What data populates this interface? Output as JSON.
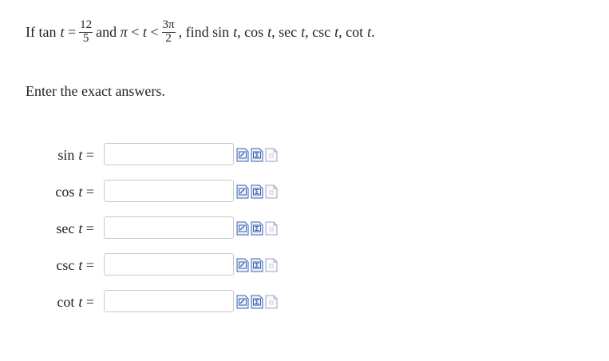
{
  "question": {
    "prefix": "If",
    "fn": "tan",
    "var": "t",
    "eq": "=",
    "frac1_num": "12",
    "frac1_den": "5",
    "and": "and",
    "pi": "π",
    "lt1": "<",
    "var2": "t",
    "lt2": "<",
    "frac2_num": "3π",
    "frac2_den": "2",
    "comma": ",",
    "find": "find",
    "targets": [
      {
        "fn": "sin",
        "var": "t",
        "sep": ","
      },
      {
        "fn": "cos",
        "var": "t",
        "sep": ","
      },
      {
        "fn": "sec",
        "var": "t",
        "sep": ","
      },
      {
        "fn": "csc",
        "var": "t",
        "sep": ","
      },
      {
        "fn": "cot",
        "var": "t",
        "sep": "."
      }
    ]
  },
  "instructions": "Enter the exact answers.",
  "answers": [
    {
      "fn": "sin",
      "var": "t",
      "eq": "=",
      "value": ""
    },
    {
      "fn": "cos",
      "var": "t",
      "eq": "=",
      "value": ""
    },
    {
      "fn": "sec",
      "var": "t",
      "eq": "=",
      "value": ""
    },
    {
      "fn": "csc",
      "var": "t",
      "eq": "=",
      "value": ""
    },
    {
      "fn": "cot",
      "var": "t",
      "eq": "=",
      "value": ""
    }
  ],
  "tool_icons": [
    "edit-math-icon",
    "sigma-icon",
    "file-icon"
  ],
  "colors": {
    "input_border": "#c8c8c8",
    "tool_blue": "#3a5fb0",
    "tool_grey": "#9aa6bd"
  }
}
